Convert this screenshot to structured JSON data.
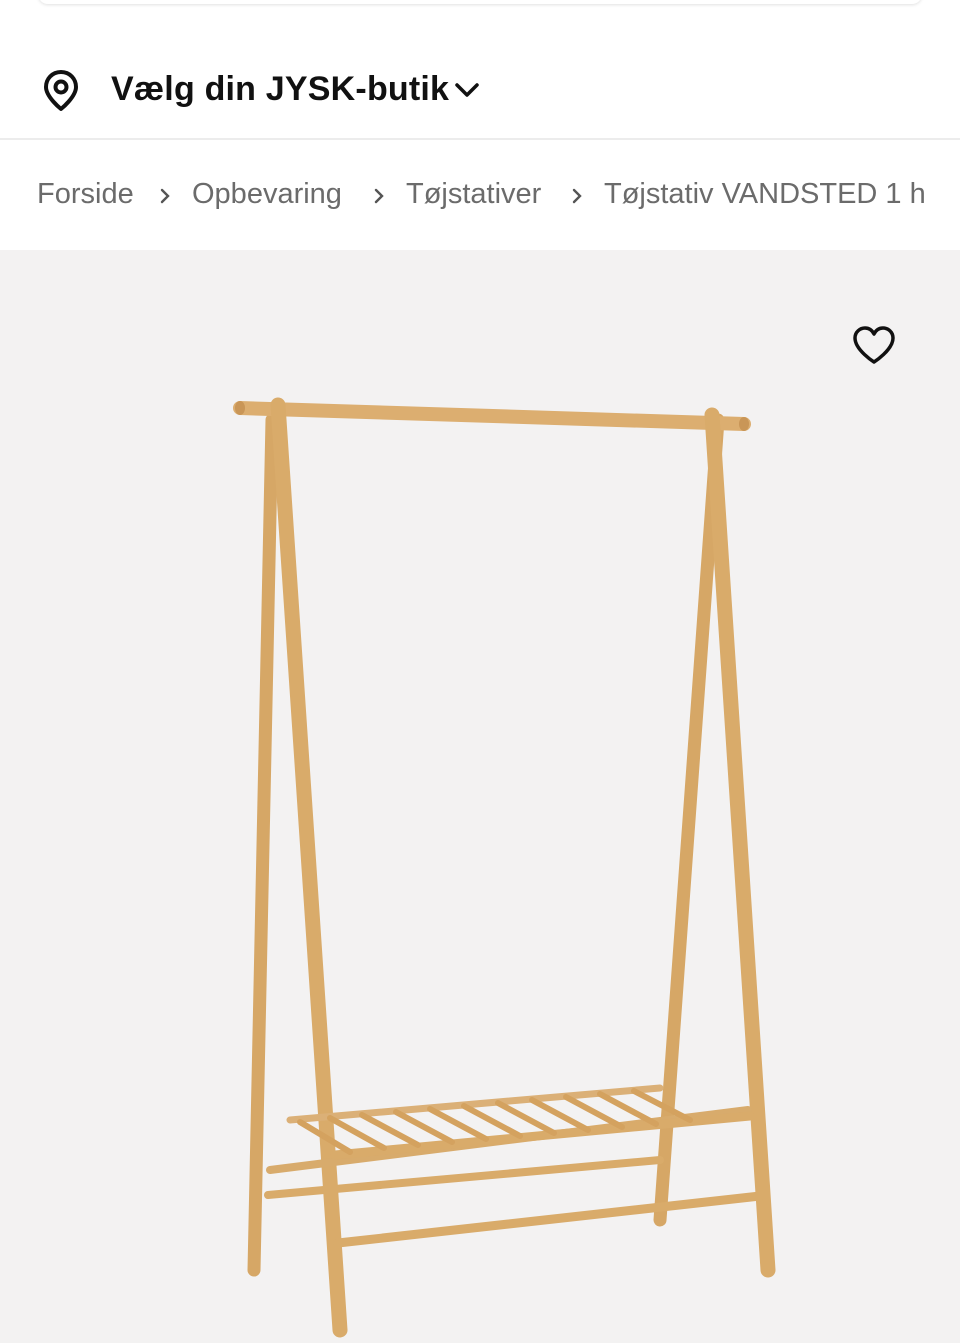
{
  "store_selector": {
    "label": "Vælg din JYSK-butik",
    "icon": "location-pin-icon",
    "dropdown_icon": "chevron-down-icon"
  },
  "breadcrumb": {
    "items": [
      "Forside",
      "Opbevaring",
      "Tøjstativer",
      "Tøjstativ VANDSTED 1 h"
    ],
    "separator_icon": "chevron-right-icon"
  },
  "product_gallery": {
    "favorite_icon": "heart-icon",
    "image": "clothes-rack-product-image",
    "background_color": "#f3f2f2",
    "wood_color": "#d9ab6a"
  }
}
